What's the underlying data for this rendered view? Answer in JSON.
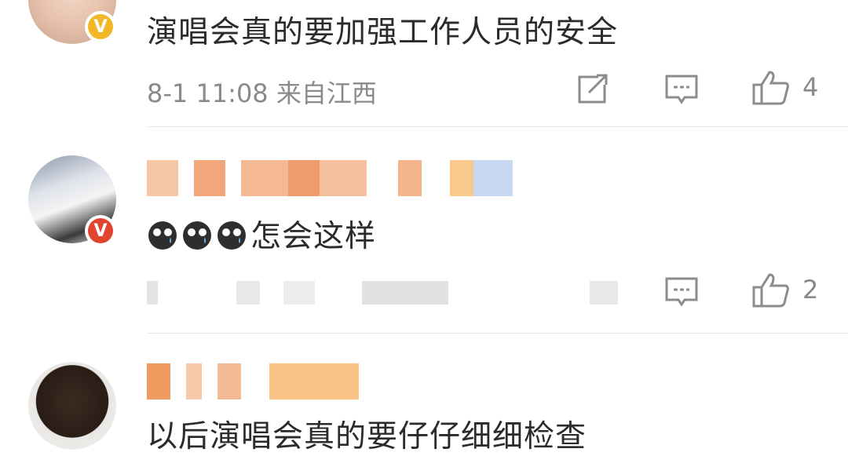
{
  "comments": [
    {
      "text": "演唱会真的要加强工作人员的安全",
      "meta": "8-1 11:08  来自江西",
      "like_count": "4",
      "badge": "V"
    },
    {
      "text": "怎会这样",
      "meta": "",
      "like_count": "2",
      "badge": "V"
    },
    {
      "text": "以后演唱会真的要仔仔细细检查",
      "meta": "",
      "like_count": "",
      "badge": ""
    }
  ],
  "colors": {
    "badge_gold": "#f3b72a",
    "badge_red": "#e2452d",
    "text": "#2b2b2b",
    "meta": "#8a8a8a",
    "icon": "#8c8c8c"
  },
  "icons": {
    "share": "share-icon",
    "comment": "comment-icon",
    "like": "thumbs-up-icon",
    "emoji": "sad-crying-emoji-icon"
  }
}
